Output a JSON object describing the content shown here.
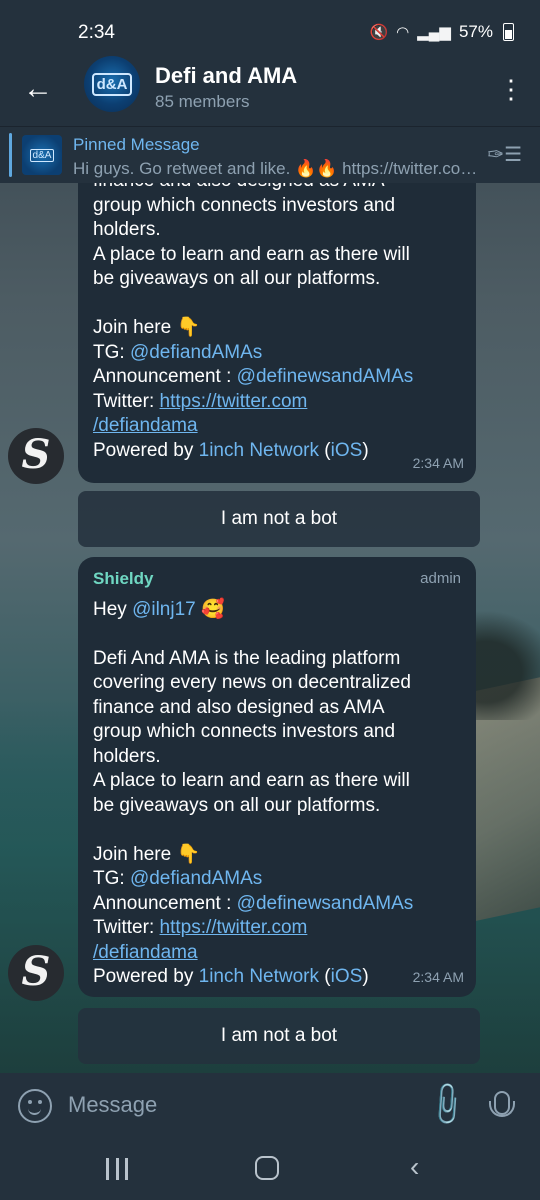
{
  "status_bar": {
    "time": "2:34",
    "battery": "57%",
    "icons": [
      "mute-icon",
      "wifi-icon",
      "signal-icon",
      "battery-icon"
    ]
  },
  "header": {
    "title": "Defi and AMA",
    "subtitle": "85 members",
    "avatar_text": "d&A"
  },
  "pinned": {
    "title": "Pinned Message",
    "text": "Hi guys. Go retweet and like. 🔥🔥 https://twitter.com/defiandama"
  },
  "messages": [
    {
      "lines_top": [
        "finance and also designed as AMA",
        "group which connects investors and",
        "holders.",
        "A place to learn and earn as there will",
        "be giveaways on all our platforms."
      ],
      "join": "Join here 👇",
      "tg_label": "TG: ",
      "tg_link": "@defiandAMAs",
      "ann_label": "Announcement : ",
      "ann_link": "@definewsandAMAs",
      "tw_label": "Twitter: ",
      "tw_url1": "https://twitter.com",
      "tw_url2": "/defiandama",
      "powered_label": "Powered by ",
      "powered_link": "1inch Network",
      "paren_open": " (",
      "ios": "iOS",
      "paren_close": ")",
      "time": "2:34 AM",
      "avatar_letter": "S"
    },
    {
      "sender": "Shieldy",
      "role": "admin",
      "greeting": "Hey ",
      "mention": "@ilnj17",
      "greeting_emoji": " 🥰",
      "lines": [
        "Defi And AMA is the leading platform",
        "covering every news on decentralized",
        "finance and also designed as AMA",
        "group which connects investors and",
        "holders.",
        "A place to learn and earn as there will",
        "be giveaways on all our platforms."
      ],
      "join": "Join here 👇",
      "tg_label": "TG: ",
      "tg_link": "@defiandAMAs",
      "ann_label": "Announcement : ",
      "ann_link": "@definewsandAMAs",
      "tw_label": "Twitter: ",
      "tw_url1": "https://twitter.com",
      "tw_url2": "/defiandama",
      "powered_label": "Powered by ",
      "powered_link": "1inch Network",
      "paren_open": " (",
      "ios": "iOS",
      "paren_close": ")",
      "time": "2:34 AM",
      "avatar_letter": "S"
    }
  ],
  "bot_button_label": "I am not a bot",
  "input": {
    "placeholder": "Message"
  },
  "colors": {
    "accent": "#6fb6ef",
    "sender": "#6fd7c2",
    "bubble": "#1f2c38",
    "bar": "#24313d"
  }
}
